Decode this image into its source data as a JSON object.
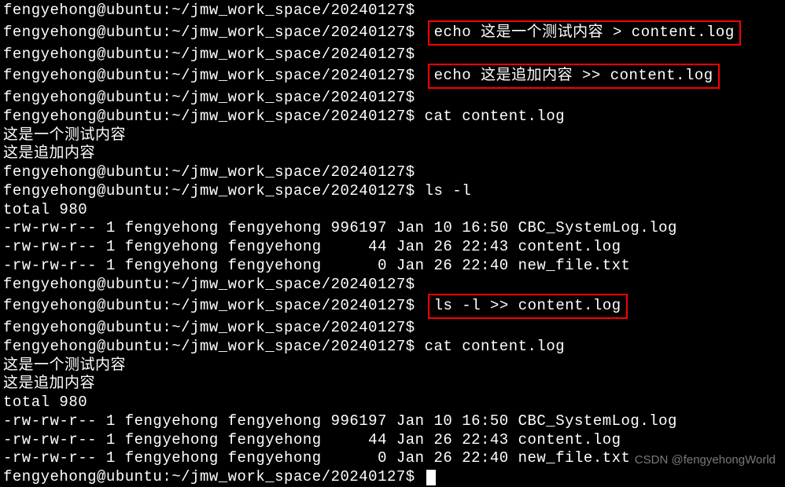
{
  "prompt": "fengyehong@ubuntu:~/jmw_work_space/20240127$",
  "commands": {
    "echo_overwrite": "echo 这是一个测试内容 > content.log",
    "echo_append": "echo 这是追加内容 >> content.log",
    "cat": "cat content.log",
    "ls": "ls -l",
    "ls_append": "ls -l >> content.log"
  },
  "output": {
    "cat1_line1": "这是一个测试内容",
    "cat1_line2": "这是追加内容",
    "ls_total": "total 980",
    "ls_file1": "-rw-rw-r-- 1 fengyehong fengyehong 996197 Jan 10 16:50 CBC_SystemLog.log",
    "ls_file2": "-rw-rw-r-- 1 fengyehong fengyehong     44 Jan 26 22:43 content.log",
    "ls_file3": "-rw-rw-r-- 1 fengyehong fengyehong      0 Jan 26 22:40 new_file.txt",
    "cat2_line1": "这是一个测试内容",
    "cat2_line2": "这是追加内容",
    "cat2_total": "total 980",
    "cat2_file1": "-rw-rw-r-- 1 fengyehong fengyehong 996197 Jan 10 16:50 CBC_SystemLog.log",
    "cat2_file2": "-rw-rw-r-- 1 fengyehong fengyehong     44 Jan 26 22:43 content.log",
    "cat2_file3": "-rw-rw-r-- 1 fengyehong fengyehong      0 Jan 26 22:40 new_file.txt"
  },
  "watermark": "CSDN @fengyehongWorld"
}
